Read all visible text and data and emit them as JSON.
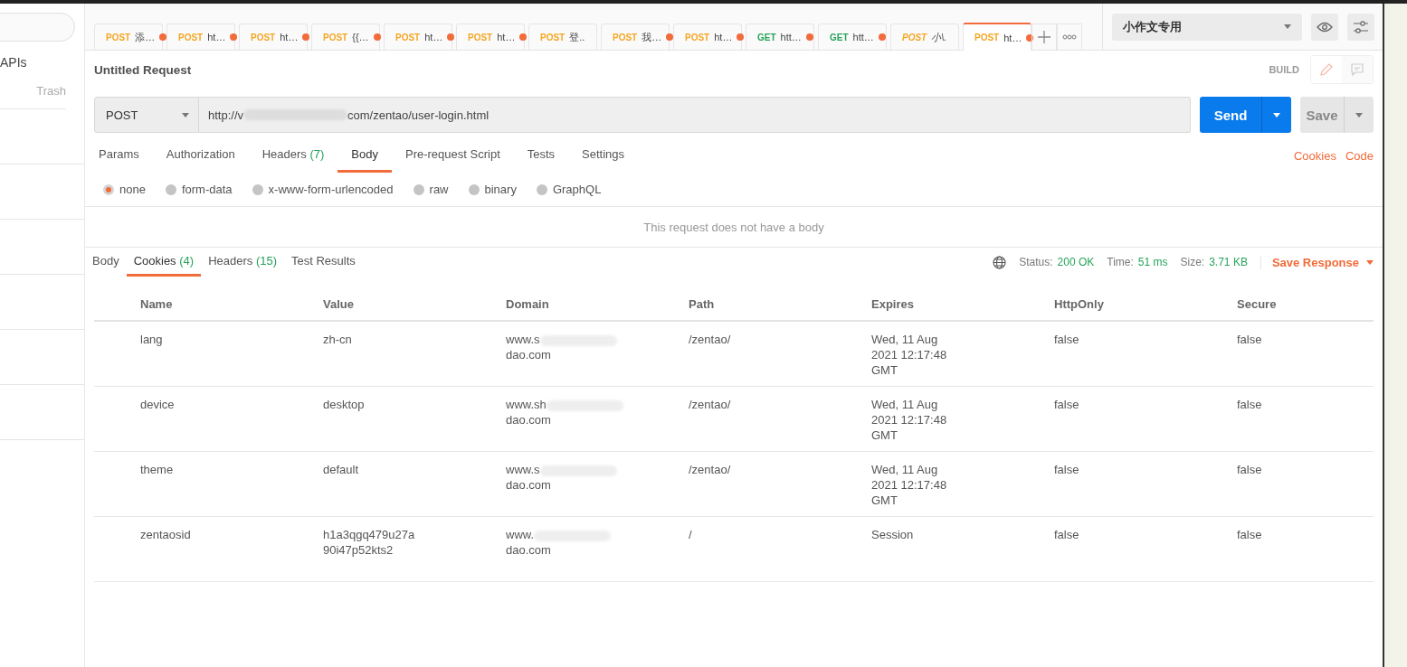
{
  "sidebar": {
    "items": [
      {
        "label": "APIs"
      },
      {
        "label": "Trash"
      }
    ]
  },
  "tabs": [
    {
      "method": "POST",
      "label": "添…",
      "modified": true,
      "preview": false,
      "selected": false
    },
    {
      "method": "POST",
      "label": "ht…",
      "modified": true,
      "preview": false,
      "selected": false
    },
    {
      "method": "POST",
      "label": "ht…",
      "modified": true,
      "preview": false,
      "selected": false
    },
    {
      "method": "POST",
      "label": "{{…",
      "modified": true,
      "preview": false,
      "selected": false
    },
    {
      "method": "POST",
      "label": "ht…",
      "modified": true,
      "preview": false,
      "selected": false
    },
    {
      "method": "POST",
      "label": "ht…",
      "modified": true,
      "preview": false,
      "selected": false
    },
    {
      "method": "POST",
      "label": "登..",
      "modified": false,
      "preview": false,
      "selected": false
    },
    {
      "method": "POST",
      "label": "我…",
      "modified": true,
      "preview": false,
      "selected": false
    },
    {
      "method": "POST",
      "label": "ht…",
      "modified": true,
      "preview": false,
      "selected": false
    },
    {
      "method": "GET",
      "label": "htt…",
      "modified": true,
      "preview": false,
      "selected": false
    },
    {
      "method": "GET",
      "label": "htt…",
      "modified": true,
      "preview": false,
      "selected": false
    },
    {
      "method": "POST",
      "label": "小\\.",
      "modified": false,
      "preview": true,
      "selected": false
    },
    {
      "method": "POST",
      "label": "ht…",
      "modified": true,
      "preview": false,
      "selected": true
    }
  ],
  "environment": {
    "value": "小作文专用"
  },
  "request": {
    "title": "Untitled Request",
    "mode": "BUILD",
    "method": "POST",
    "url_start": "http://v",
    "url_end": "com/zentao/user-login.html",
    "send": "Send",
    "save": "Save"
  },
  "request_tabs": [
    {
      "label": "Params",
      "selected": false
    },
    {
      "label": "Authorization",
      "selected": false
    },
    {
      "label": "Headers",
      "count": "(7)",
      "selected": false
    },
    {
      "label": "Body",
      "selected": true
    },
    {
      "label": "Pre-request Script",
      "selected": false
    },
    {
      "label": "Tests",
      "selected": false
    },
    {
      "label": "Settings",
      "selected": false
    }
  ],
  "request_links": [
    "Cookies",
    "Code"
  ],
  "body_types": [
    {
      "label": "none",
      "selected": true
    },
    {
      "label": "form-data",
      "selected": false
    },
    {
      "label": "x-www-form-urlencoded",
      "selected": false
    },
    {
      "label": "raw",
      "selected": false
    },
    {
      "label": "binary",
      "selected": false
    },
    {
      "label": "GraphQL",
      "selected": false
    }
  ],
  "body_message": "This request does not have a body",
  "response_tabs": [
    {
      "label": "Body",
      "selected": false
    },
    {
      "label": "Cookies",
      "count": "(4)",
      "selected": true
    },
    {
      "label": "Headers",
      "count": "(15)",
      "selected": false
    },
    {
      "label": "Test Results",
      "selected": false
    }
  ],
  "response_stats": [
    {
      "label": "Status:",
      "value": "200 OK"
    },
    {
      "label": "Time:",
      "value": "51 ms"
    },
    {
      "label": "Size:",
      "value": "3.71 KB"
    }
  ],
  "save_response": "Save Response",
  "table": {
    "columns": [
      "Name",
      "Value",
      "Domain",
      "Path",
      "Expires",
      "HttpOnly",
      "Secure"
    ],
    "rows": [
      {
        "name": "lang",
        "value": "zh-cn",
        "domain_start": "www.s",
        "domain_end": "dao.com",
        "path": "/zentao/",
        "expires": "Wed, 11 Aug 2021 12:17:48 GMT",
        "httponly": "false",
        "secure": "false"
      },
      {
        "name": "device",
        "value": "desktop",
        "domain_start": "www.sh",
        "domain_end": "dao.com",
        "path": "/zentao/",
        "expires": "Wed, 11 Aug 2021 12:17:48 GMT",
        "httponly": "false",
        "secure": "false"
      },
      {
        "name": "theme",
        "value": "default",
        "domain_start": "www.s",
        "domain_end": "dao.com",
        "path": "/zentao/",
        "expires": "Wed, 11 Aug 2021 12:17:48 GMT",
        "httponly": "false",
        "secure": "false"
      },
      {
        "name": "zentaosid",
        "value": "h1a3qgq479u27a 90i47p52kts2",
        "domain_start": "www.",
        "domain_end": "dao.com",
        "path": "/",
        "expires": "Session",
        "httponly": "false",
        "secure": "false"
      }
    ]
  }
}
